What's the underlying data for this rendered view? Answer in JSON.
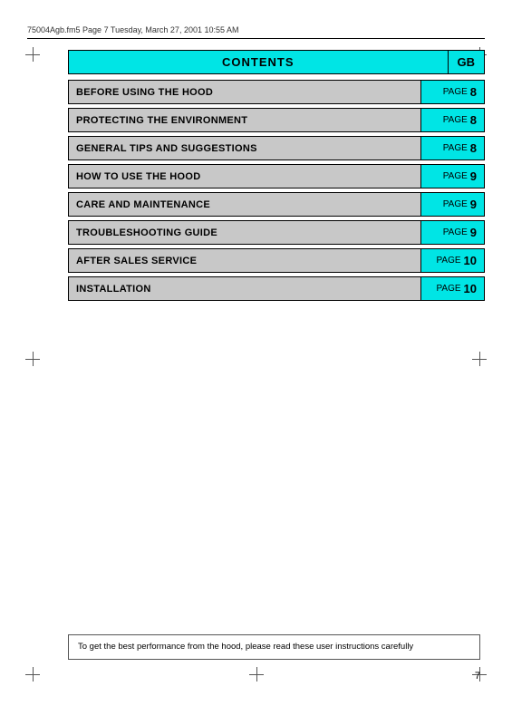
{
  "header": {
    "filename": "75004Agb.fm5  Page 7  Tuesday, March 27, 2001  10:55 AM"
  },
  "contents": {
    "title": "CONTENTS",
    "gb_label": "GB"
  },
  "toc": {
    "items": [
      {
        "label": "BEFORE USING THE HOOD",
        "page_word": "PAGE",
        "page_num": "8"
      },
      {
        "label": "PROTECTING THE ENVIRONMENT",
        "page_word": "PAGE",
        "page_num": "8"
      },
      {
        "label": "GENERAL TIPS AND SUGGESTIONS",
        "page_word": "PAGE",
        "page_num": "8"
      },
      {
        "label": "HOW TO USE THE HOOD",
        "page_word": "PAGE",
        "page_num": "9"
      },
      {
        "label": "CARE AND MAINTENANCE",
        "page_word": "PAGE",
        "page_num": "9"
      },
      {
        "label": "TROUBLESHOOTING GUIDE",
        "page_word": "PAGE",
        "page_num": "9"
      },
      {
        "label": "AFTER SALES SERVICE",
        "page_word": "PAGE",
        "page_num": "10"
      },
      {
        "label": "INSTALLATION",
        "page_word": "PAGE",
        "page_num": "10"
      }
    ]
  },
  "footer": {
    "note": "To get the best performance from the hood, please read these user instructions carefully"
  },
  "page_number": "7"
}
